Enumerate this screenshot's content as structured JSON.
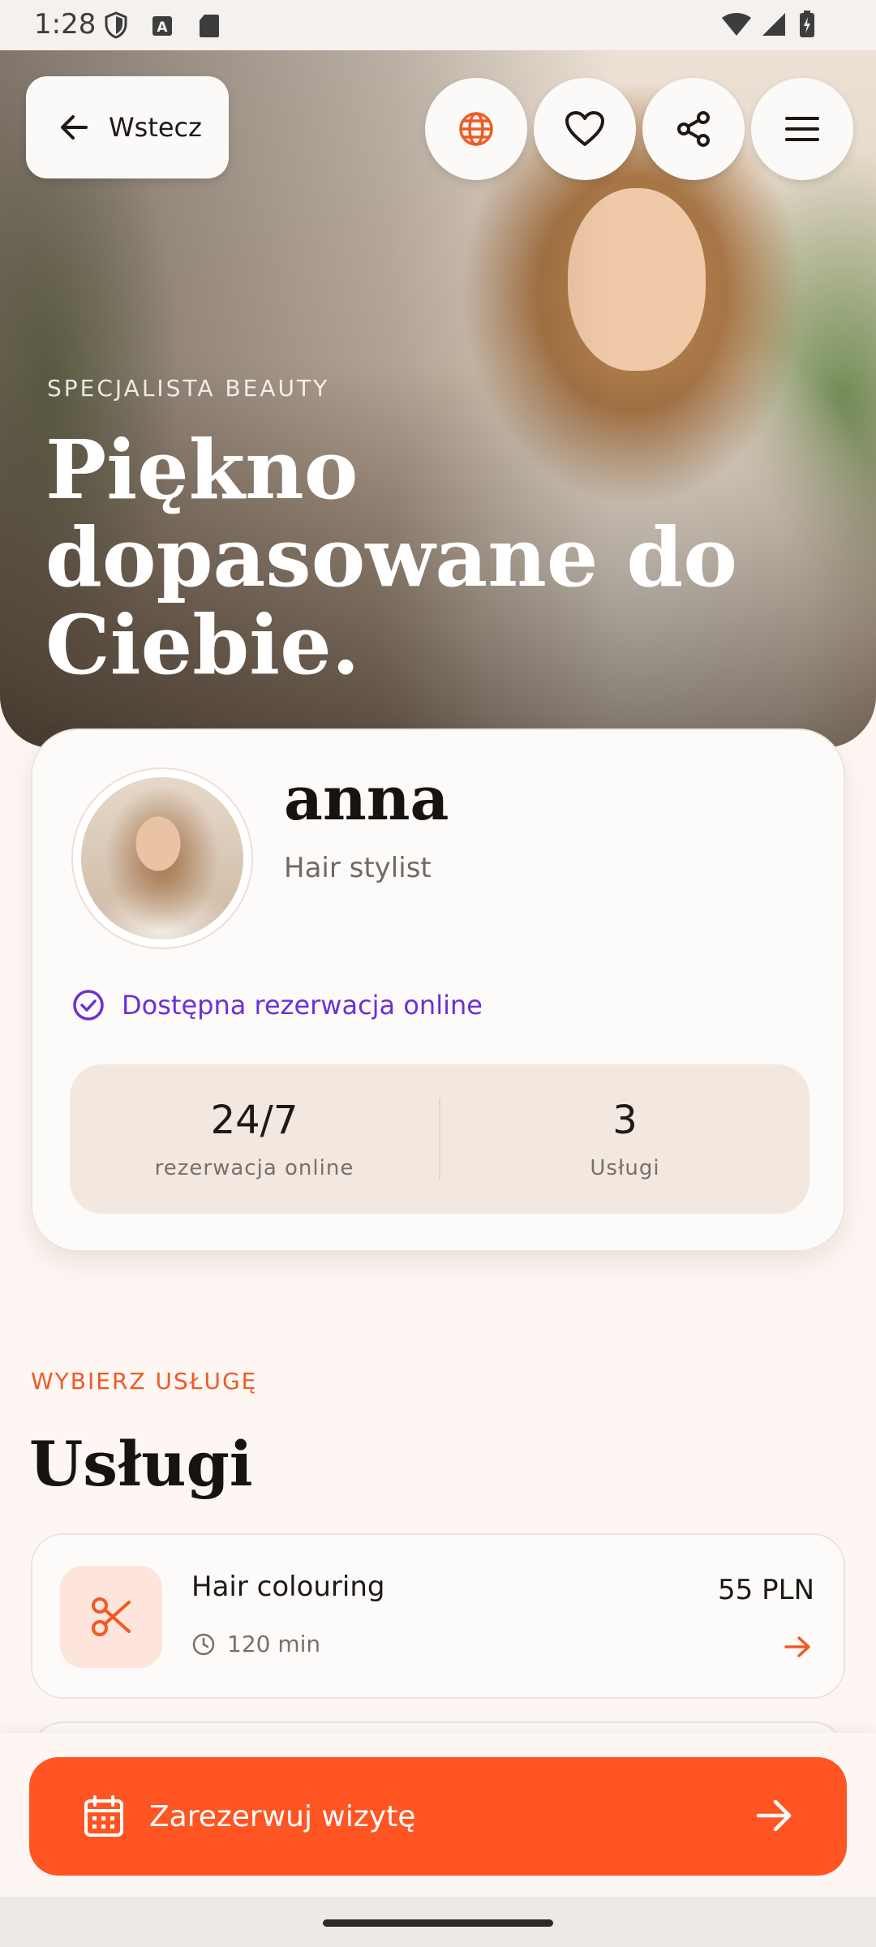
{
  "status_bar": {
    "time": "1:28"
  },
  "header": {
    "back_label": "Wstecz"
  },
  "hero": {
    "eyebrow": "SPECJALISTA BEAUTY",
    "headline": "Piękno dopasowane do Ciebie."
  },
  "profile": {
    "name": "anna",
    "role": "Hair stylist",
    "online_booking": "Dostępna rezerwacja online",
    "stats": [
      {
        "value": "24/7",
        "label": "rezerwacja online"
      },
      {
        "value": "3",
        "label": "Usługi"
      }
    ]
  },
  "services": {
    "eyebrow": "WYBIERZ USŁUGĘ",
    "title": "Usługi",
    "items": [
      {
        "name": "Hair colouring",
        "duration": "120 min",
        "price": "55 PLN"
      }
    ]
  },
  "cta": {
    "label": "Zarezerwuj wizytę"
  },
  "colors": {
    "accent": "#ff5522",
    "online": "#6d2fd6",
    "accent_soft": "#fde5dc"
  }
}
